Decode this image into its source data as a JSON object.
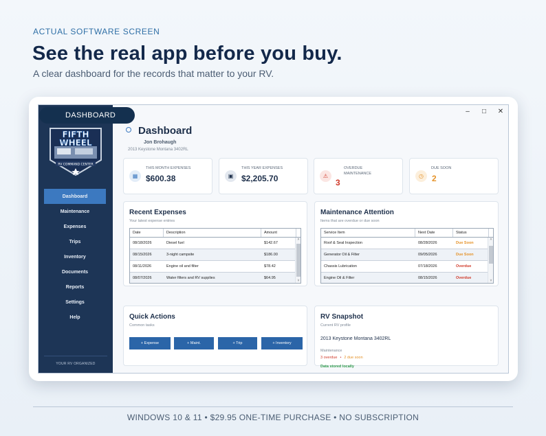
{
  "marketing": {
    "eyebrow": "ACTUAL SOFTWARE SCREEN",
    "headline": "See the real app before you buy.",
    "subhead": "A clear dashboard for the records that matter to your RV.",
    "footer": "WINDOWS 10 & 11  •  $29.95 ONE-TIME PURCHASE  •  NO SUBSCRIPTION"
  },
  "window_controls": {
    "minimize": "–",
    "maximize": "□",
    "close": "✕"
  },
  "badge": "DASHBOARD",
  "logo": {
    "line1": "FIFTH",
    "line2": "WHEEL",
    "banner": "RV COMMAND CENTER"
  },
  "sidebar": {
    "items": [
      {
        "label": "Dashboard",
        "active": true
      },
      {
        "label": "Maintenance"
      },
      {
        "label": "Expenses"
      },
      {
        "label": "Trips"
      },
      {
        "label": "Inventory"
      },
      {
        "label": "Documents"
      },
      {
        "label": "Reports"
      },
      {
        "label": "Settings"
      },
      {
        "label": "Help"
      }
    ],
    "footer": "YOUR RV ORGANIZED"
  },
  "dashboard": {
    "title": "Dashboard",
    "user": "Jon Brohaugh",
    "rv": "2013 Keystone Montana 3402RL"
  },
  "kpis": {
    "month": {
      "label": "THIS MONTH EXPENSES",
      "value": "$600.38",
      "icon": "calendar-icon"
    },
    "year": {
      "label": "THIS YEAR EXPENSES",
      "value": "$2,205.70",
      "icon": "calendar-icon"
    },
    "overdue": {
      "label1": "OVERDUE",
      "label2": "MAINTENANCE",
      "value": "3",
      "icon": "warning-icon"
    },
    "due": {
      "label": "DUE SOON",
      "value": "2",
      "icon": "clock-icon"
    }
  },
  "recent_expenses": {
    "title": "Recent Expenses",
    "subtitle": "Your latest expense entries",
    "columns": [
      "Date",
      "Description",
      "Amount"
    ],
    "rows": [
      [
        "08/18/2026",
        "Diesel fuel",
        "$142.67"
      ],
      [
        "08/15/2026",
        "3-night campsite",
        "$186.00"
      ],
      [
        "08/11/2026",
        "Engine oil and filter",
        "$78.42"
      ],
      [
        "08/07/2026",
        "Water filters and RV supplies",
        "$64.95"
      ]
    ]
  },
  "maintenance_attention": {
    "title": "Maintenance Attention",
    "subtitle": "Items that are overdue or due soon",
    "columns": [
      "Service Item",
      "Next Date",
      "Status"
    ],
    "rows": [
      [
        "Roof & Seal Inspection",
        "08/28/2026",
        "Due Soon"
      ],
      [
        "Generator Oil & Filter",
        "09/05/2026",
        "Due Soon"
      ],
      [
        "Chassis Lubrication",
        "07/18/2026",
        "Overdue"
      ],
      [
        "Engine Oil & Filter",
        "08/15/2026",
        "Overdue"
      ]
    ]
  },
  "quick_actions": {
    "title": "Quick Actions",
    "subtitle": "Common tasks",
    "buttons": [
      "+ Expense",
      "+ Maint.",
      "+ Trip",
      "+ Inventory"
    ]
  },
  "rv_snapshot": {
    "title": "RV Snapshot",
    "subtitle": "Current RV profile",
    "name": "2013 Keystone Montana 3402RL",
    "maint_label": "Maintenance",
    "overdue": "3 overdue",
    "sep": "•",
    "due": "2 due soon",
    "stored": "Data stored locally"
  },
  "colors": {
    "sidebar": "#1d3556",
    "accent": "#3c79c0",
    "button": "#2b65a8",
    "overdue": "#d03a2a",
    "due_soon": "#e5932a",
    "ok": "#2e9a4a"
  }
}
